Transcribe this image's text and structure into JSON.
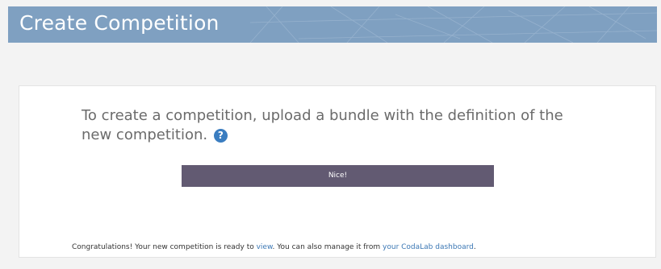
{
  "header": {
    "title": "Create Competition"
  },
  "intro": {
    "text": "To create a competition, upload a bundle with the definition of the new competition.",
    "help_icon": "question-circle-icon",
    "help_glyph": "?"
  },
  "upload": {
    "status_label": "Nice!"
  },
  "congratulations": {
    "prefix": "Congratulations! Your new competition is ready to ",
    "view_link": "view",
    "middle": ". You can also manage it from ",
    "dashboard_link": "your CodaLab dashboard",
    "suffix": "."
  },
  "colors": {
    "banner": "#7fa0c1",
    "status_bar": "#625a72",
    "link": "#3b77b4",
    "help_icon": "#3a7dc0"
  }
}
